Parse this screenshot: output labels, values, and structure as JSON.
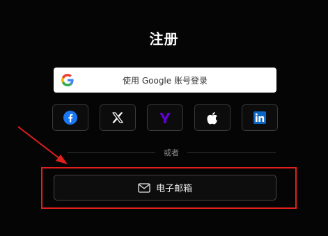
{
  "page": {
    "title": "注册"
  },
  "google_button": {
    "label": "使用 Google 账号登录",
    "icon": "google-icon"
  },
  "social_buttons": [
    {
      "name": "facebook",
      "icon": "facebook-icon",
      "color": "#1877f2"
    },
    {
      "name": "x",
      "icon": "x-icon",
      "color": "#ffffff"
    },
    {
      "name": "yahoo",
      "icon": "yahoo-icon",
      "color": "#6001d2"
    },
    {
      "name": "apple",
      "icon": "apple-icon",
      "color": "#ffffff"
    },
    {
      "name": "linkedin",
      "icon": "linkedin-icon",
      "color": "#0a66c2"
    }
  ],
  "divider": {
    "text": "或者"
  },
  "email_button": {
    "label": "电子邮箱",
    "icon": "mail-icon"
  },
  "annotation": {
    "highlight_color": "#e0201c"
  }
}
